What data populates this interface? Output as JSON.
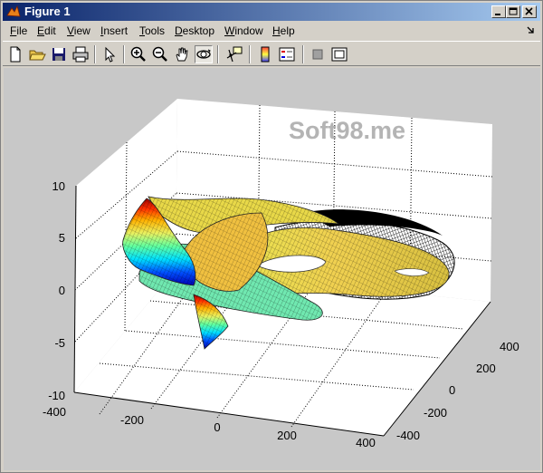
{
  "window": {
    "title": "Figure 1"
  },
  "menu": {
    "items": [
      {
        "accel": "F",
        "rest": "ile"
      },
      {
        "accel": "E",
        "rest": "dit"
      },
      {
        "accel": "V",
        "rest": "iew"
      },
      {
        "accel": "I",
        "rest": "nsert"
      },
      {
        "accel": "T",
        "rest": "ools"
      },
      {
        "accel": "D",
        "rest": "esktop"
      },
      {
        "accel": "W",
        "rest": "indow"
      },
      {
        "accel": "H",
        "rest": "elp"
      }
    ]
  },
  "toolbar": {
    "buttons": [
      "new-figure",
      "open-file",
      "save-figure",
      "print-figure",
      "edit-plot",
      "zoom-in",
      "zoom-out",
      "pan",
      "rotate-3d",
      "data-cursor",
      "insert-colorbar",
      "insert-legend",
      "hide-plot-tools",
      "show-plot-tools"
    ],
    "active": "rotate-3d"
  },
  "watermark": "Soft98.me",
  "axes": {
    "z_ticks": [
      "10",
      "5",
      "0",
      "-5",
      "-10"
    ],
    "x_ticks": [
      "-400",
      "-200",
      "0",
      "200",
      "400"
    ],
    "y_ticks": [
      "400",
      "200",
      "0",
      "-200",
      "-400"
    ],
    "grid": true,
    "colormap": "jet"
  }
}
